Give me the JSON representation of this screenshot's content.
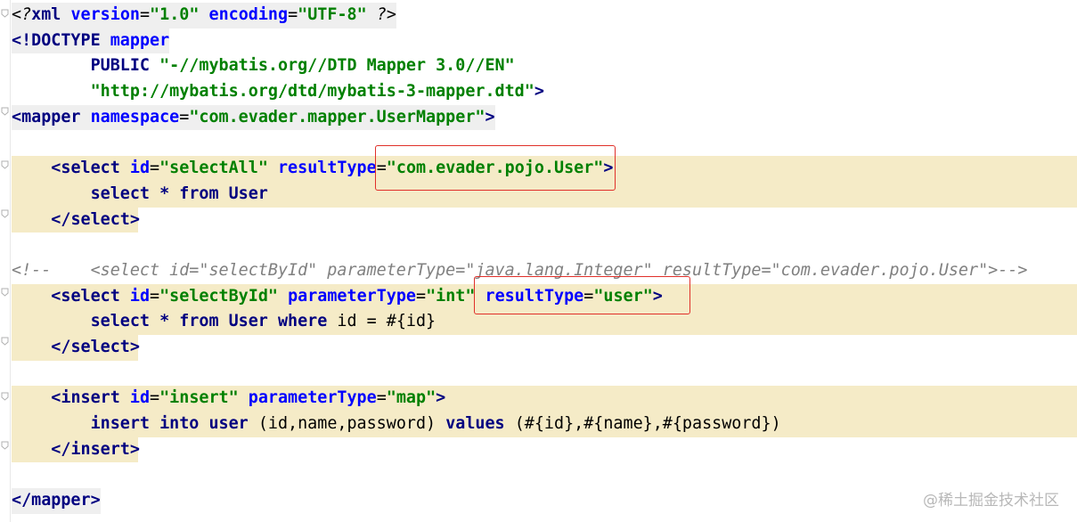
{
  "lines": [
    {
      "segments": [
        {
          "t": "<?",
          "c": "pi"
        },
        {
          "t": "xml ",
          "c": "tag"
        },
        {
          "t": "version",
          "c": "attr"
        },
        {
          "t": "=",
          "c": "txt"
        },
        {
          "t": "\"1.0\"",
          "c": "val"
        },
        {
          "t": " ",
          "c": "txt"
        },
        {
          "t": "encoding",
          "c": "attr"
        },
        {
          "t": "=",
          "c": "txt"
        },
        {
          "t": "\"UTF-8\"",
          "c": "val"
        },
        {
          "t": " ?>",
          "c": "pi"
        }
      ],
      "bg": "prolog"
    },
    {
      "segments": [
        {
          "t": "<!DOCTYPE ",
          "c": "tag"
        },
        {
          "t": "mapper",
          "c": "attr"
        }
      ],
      "bg": "prolog"
    },
    {
      "segments": [
        {
          "t": "        PUBLIC ",
          "c": "kw"
        },
        {
          "t": "\"-//mybatis.org//DTD Mapper 3.0//EN\"",
          "c": "val"
        }
      ],
      "bg": "none"
    },
    {
      "segments": [
        {
          "t": "        ",
          "c": "txt"
        },
        {
          "t": "\"http://mybatis.org/dtd/mybatis-3-mapper.dtd\"",
          "c": "val"
        },
        {
          "t": ">",
          "c": "tag"
        }
      ],
      "bg": "none"
    },
    {
      "segments": [
        {
          "t": "<mapper ",
          "c": "tag"
        },
        {
          "t": "namespace",
          "c": "attr"
        },
        {
          "t": "=",
          "c": "txt"
        },
        {
          "t": "\"com.evader.mapper.UserMapper\"",
          "c": "val"
        },
        {
          "t": ">",
          "c": "tag"
        }
      ],
      "bg": "prolog"
    },
    {
      "segments": [
        {
          "t": " ",
          "c": "txt"
        }
      ],
      "bg": "none"
    },
    {
      "segments": [
        {
          "t": "    ",
          "c": "txt"
        },
        {
          "t": "<select ",
          "c": "tag"
        },
        {
          "t": "id",
          "c": "attr"
        },
        {
          "t": "=",
          "c": "txt"
        },
        {
          "t": "\"selectAll\"",
          "c": "val"
        },
        {
          "t": " ",
          "c": "txt"
        },
        {
          "t": "resultType",
          "c": "attr"
        },
        {
          "t": "=",
          "c": "txt"
        },
        {
          "t": "\"com.evader.pojo.User\"",
          "c": "val"
        },
        {
          "t": ">",
          "c": "tag"
        }
      ],
      "bg": "hl"
    },
    {
      "segments": [
        {
          "t": "        select * from User",
          "c": "kw"
        }
      ],
      "bg": "hl"
    },
    {
      "segments": [
        {
          "t": "    ",
          "c": "txt"
        },
        {
          "t": "</select>",
          "c": "tag"
        }
      ],
      "bg": "hl-short"
    },
    {
      "segments": [
        {
          "t": " ",
          "c": "txt"
        }
      ],
      "bg": "none"
    },
    {
      "segments": [
        {
          "t": "<!--    <select id=\"selectById\" parameterType=\"java.lang.Integer\" resultType=\"com.evader.pojo.User\">-->",
          "c": "cmt"
        }
      ],
      "bg": "none"
    },
    {
      "segments": [
        {
          "t": "    ",
          "c": "txt"
        },
        {
          "t": "<select ",
          "c": "tag"
        },
        {
          "t": "id",
          "c": "attr"
        },
        {
          "t": "=",
          "c": "txt"
        },
        {
          "t": "\"selectById\"",
          "c": "val"
        },
        {
          "t": " ",
          "c": "txt"
        },
        {
          "t": "parameterType",
          "c": "attr"
        },
        {
          "t": "=",
          "c": "txt"
        },
        {
          "t": "\"int\"",
          "c": "val"
        },
        {
          "t": " ",
          "c": "txt"
        },
        {
          "t": "resultType",
          "c": "attr"
        },
        {
          "t": "=",
          "c": "txt"
        },
        {
          "t": "\"user\"",
          "c": "val"
        },
        {
          "t": ">",
          "c": "tag"
        }
      ],
      "bg": "hl"
    },
    {
      "segments": [
        {
          "t": "        select * from User where ",
          "c": "kw"
        },
        {
          "t": "id = #{id}",
          "c": "txt"
        }
      ],
      "bg": "hl"
    },
    {
      "segments": [
        {
          "t": "    ",
          "c": "txt"
        },
        {
          "t": "</select>",
          "c": "tag"
        }
      ],
      "bg": "hl-short"
    },
    {
      "segments": [
        {
          "t": " ",
          "c": "txt"
        }
      ],
      "bg": "none"
    },
    {
      "segments": [
        {
          "t": "    ",
          "c": "txt"
        },
        {
          "t": "<insert ",
          "c": "tag"
        },
        {
          "t": "id",
          "c": "attr"
        },
        {
          "t": "=",
          "c": "txt"
        },
        {
          "t": "\"insert\"",
          "c": "val"
        },
        {
          "t": " ",
          "c": "txt"
        },
        {
          "t": "parameterType",
          "c": "attr"
        },
        {
          "t": "=",
          "c": "txt"
        },
        {
          "t": "\"map\"",
          "c": "val"
        },
        {
          "t": ">",
          "c": "tag"
        }
      ],
      "bg": "hl"
    },
    {
      "segments": [
        {
          "t": "        insert into user ",
          "c": "kw"
        },
        {
          "t": "(id,name,password) ",
          "c": "txt"
        },
        {
          "t": "values ",
          "c": "kw"
        },
        {
          "t": "(#{id},#{name},#{password})",
          "c": "txt"
        }
      ],
      "bg": "hl"
    },
    {
      "segments": [
        {
          "t": "    ",
          "c": "txt"
        },
        {
          "t": "</insert>",
          "c": "tag"
        }
      ],
      "bg": "hl-short"
    },
    {
      "segments": [
        {
          "t": " ",
          "c": "txt"
        }
      ],
      "bg": "none"
    },
    {
      "segments": [
        {
          "t": "</mapper>",
          "c": "tag"
        }
      ],
      "bg": "prolog"
    }
  ],
  "watermark": "@稀土掘金技术社区",
  "colors": {
    "tag": "#000080",
    "attr": "#0000ff",
    "value": "#008000",
    "comment": "#808080",
    "highlight": "#f5ebc7",
    "annotation_box": "#e0302a"
  }
}
